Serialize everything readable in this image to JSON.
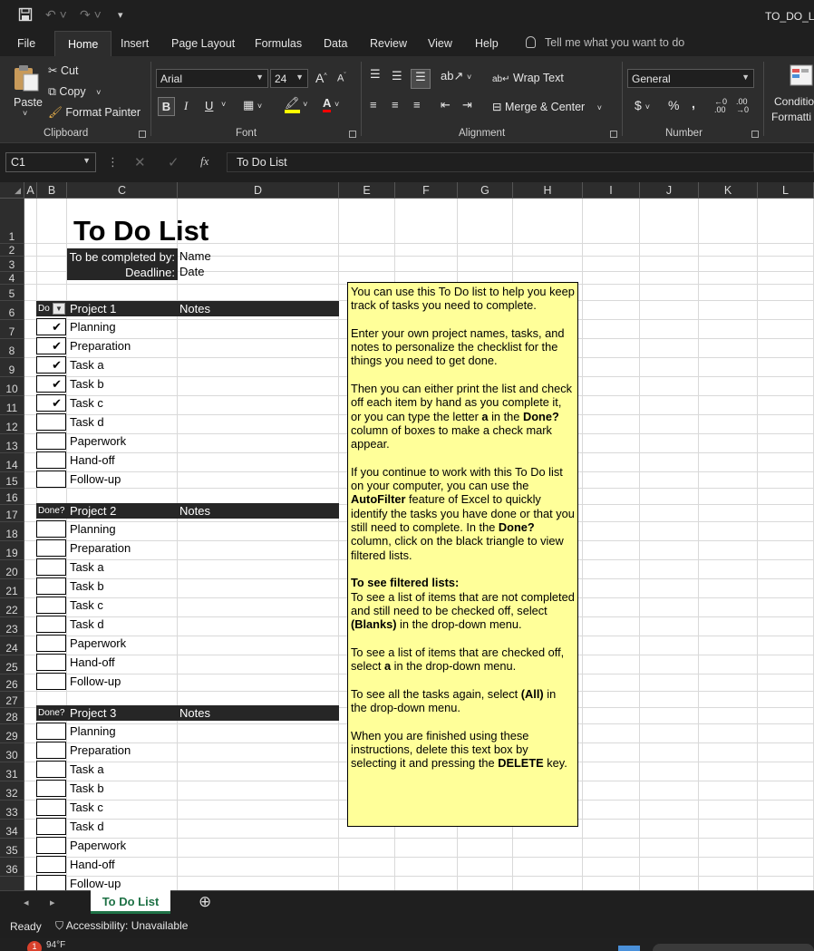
{
  "titlebar": {
    "doc_title": "TO_DO_LIS"
  },
  "tabs": {
    "file": "File",
    "home": "Home",
    "insert": "Insert",
    "page_layout": "Page Layout",
    "formulas": "Formulas",
    "data": "Data",
    "review": "Review",
    "view": "View",
    "help": "Help",
    "tell_me": "Tell me what you want to do"
  },
  "ribbon": {
    "paste": "Paste",
    "cut": "Cut",
    "copy": "Copy",
    "format_painter": "Format Painter",
    "clipboard": "Clipboard",
    "font_name": "Arial",
    "font_size": "24",
    "font": "Font",
    "bold": "B",
    "italic": "I",
    "underline": "U",
    "wrap_text": "Wrap Text",
    "merge_center": "Merge & Center",
    "alignment": "Alignment",
    "number_format": "General",
    "number": "Number",
    "currency": "$",
    "percent": "%",
    "comma": ",",
    "cond_format_1": "Conditio",
    "cond_format_2": "Formatti"
  },
  "formula_bar": {
    "name_box": "C1",
    "formula": "To Do List"
  },
  "columns": [
    "A",
    "B",
    "C",
    "D",
    "E",
    "F",
    "G",
    "H",
    "I",
    "J",
    "K",
    "L"
  ],
  "rows": [
    "1",
    "2",
    "3",
    "4",
    "5",
    "6",
    "7",
    "8",
    "9",
    "10",
    "11",
    "12",
    "13",
    "14",
    "15",
    "16",
    "17",
    "18",
    "19",
    "20",
    "21",
    "22",
    "23",
    "24",
    "25",
    "26",
    "27",
    "28",
    "29",
    "30",
    "31",
    "32",
    "33",
    "34",
    "35",
    "36"
  ],
  "sheet": {
    "title": "To Do List",
    "completed_by_label": "To be completed by:",
    "completed_by_value": "Name",
    "deadline_label": "Deadline:",
    "deadline_value": "Date",
    "done_label_short": "Do",
    "done_label": "Done?",
    "notes_label": "Notes",
    "check_mark": "✔",
    "projects": [
      {
        "name": "Project 1",
        "tasks": [
          {
            "label": "Planning",
            "done": "✔"
          },
          {
            "label": "Preparation",
            "done": "✔"
          },
          {
            "label": "Task a",
            "done": "✔"
          },
          {
            "label": "Task b",
            "done": "✔"
          },
          {
            "label": "Task c",
            "done": "✔"
          },
          {
            "label": "Task d",
            "done": ""
          },
          {
            "label": "Paperwork",
            "done": ""
          },
          {
            "label": "Hand-off",
            "done": ""
          },
          {
            "label": "Follow-up",
            "done": ""
          }
        ]
      },
      {
        "name": "Project 2",
        "tasks": [
          {
            "label": "Planning",
            "done": ""
          },
          {
            "label": "Preparation",
            "done": ""
          },
          {
            "label": "Task a",
            "done": ""
          },
          {
            "label": "Task b",
            "done": ""
          },
          {
            "label": "Task c",
            "done": ""
          },
          {
            "label": "Task d",
            "done": ""
          },
          {
            "label": "Paperwork",
            "done": ""
          },
          {
            "label": "Hand-off",
            "done": ""
          },
          {
            "label": "Follow-up",
            "done": ""
          }
        ]
      },
      {
        "name": "Project 3",
        "tasks": [
          {
            "label": "Planning",
            "done": ""
          },
          {
            "label": "Preparation",
            "done": ""
          },
          {
            "label": "Task a",
            "done": ""
          },
          {
            "label": "Task b",
            "done": ""
          },
          {
            "label": "Task c",
            "done": ""
          },
          {
            "label": "Task d",
            "done": ""
          },
          {
            "label": "Paperwork",
            "done": ""
          },
          {
            "label": "Hand-off",
            "done": ""
          },
          {
            "label": "Follow-up",
            "done": ""
          }
        ]
      }
    ]
  },
  "instructions": {
    "p1": "You can use this To Do list to help you keep track of tasks you need to complete.",
    "p2": "Enter your own project names, tasks, and notes to personalize the checklist for the things you need to get done.",
    "p3a": "Then you can either print the list and check off each item by hand as you complete it, or you can type the letter ",
    "p3b": "a",
    "p3c": " in the ",
    "p3d": "Done?",
    "p3e": " column of boxes to make a check mark appear.",
    "p4a": "If you continue to work with this To Do list on your computer, you can use the ",
    "p4b": "AutoFilter",
    "p4c": " feature of Excel to quickly identify the tasks you have done or that you still need to complete. In the ",
    "p4d": "Done?",
    "p4e": " column, click on the black triangle to view filtered lists.",
    "p5a": "To see filtered lists:",
    "p5b": "To see a list of items that are not completed and still need to be checked off, select ",
    "p5c": "(Blanks)",
    "p5d": " in the drop-down menu.",
    "p6a": "To see a list of items that are checked off, select ",
    "p6b": "a",
    "p6c": " in the drop-down menu.",
    "p7a": "To see all the tasks again, select ",
    "p7b": "(All)",
    "p7c": " in the drop-down menu.",
    "p8a": "When you are finished using these instructions, delete this text box by selecting it and pressing the ",
    "p8b": "DELETE",
    "p8c": " key."
  },
  "sheet_tab": {
    "name": "To Do List",
    "add": "⊕"
  },
  "status": {
    "ready": "Ready",
    "accessibility": "Accessibility: Unavailable",
    "weather": "94°F"
  },
  "colors": {
    "accent_green": "#1e7145",
    "note_yellow": "#ffff99",
    "header_black": "#262626"
  }
}
